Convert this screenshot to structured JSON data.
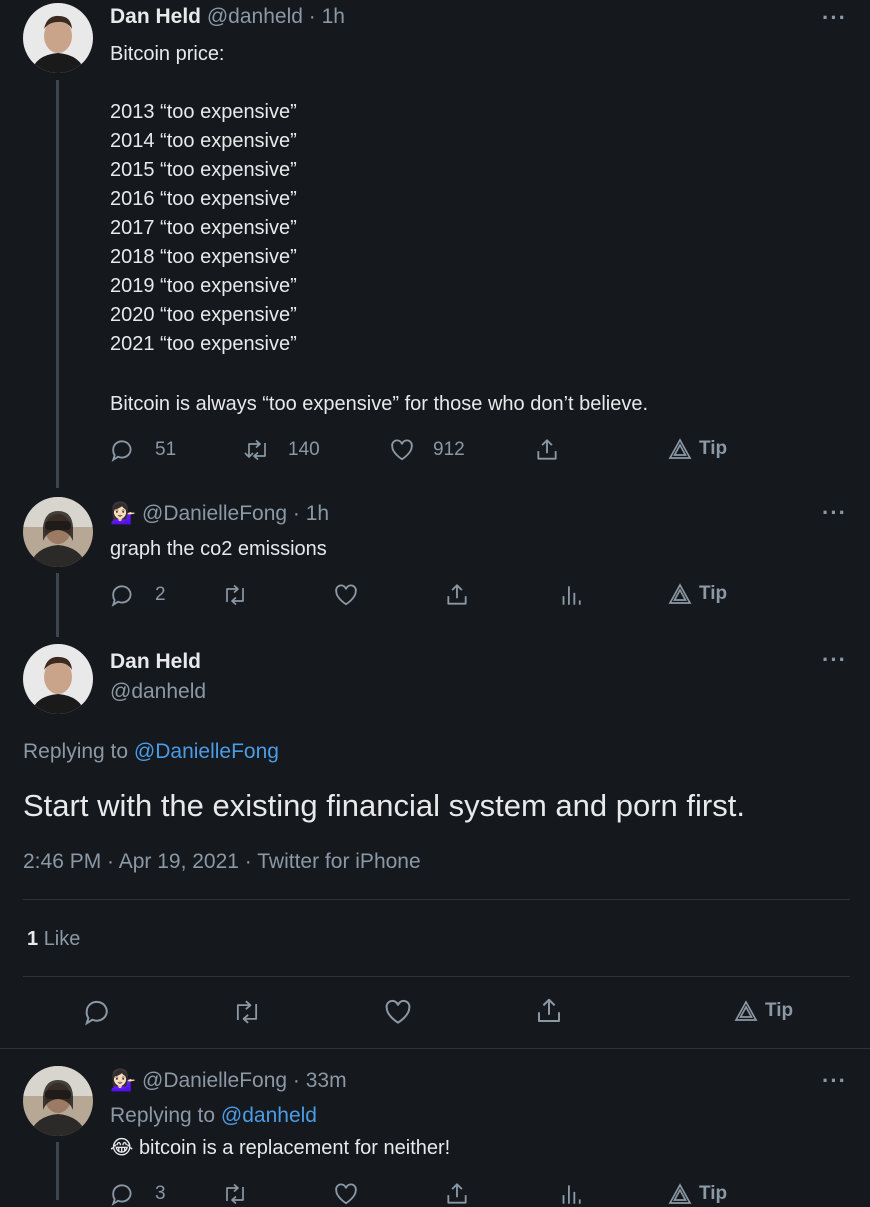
{
  "tweet1": {
    "name": "Dan Held",
    "handle": "@danheld",
    "time": "· 1h",
    "intro": "Bitcoin price:",
    "lines": [
      "2013 “too expensive”",
      "2014 “too expensive”",
      "2015 “too expensive”",
      "2016 “too expensive”",
      "2017 “too expensive”",
      "2018 “too expensive”",
      "2019 “too expensive”",
      "2020 “too expensive”",
      "2021 “too expensive”"
    ],
    "outro": "Bitcoin is always “too expensive” for those who don’t believe.",
    "replies": "51",
    "retweets": "140",
    "likes": "912",
    "tip": "Tip"
  },
  "tweet2": {
    "emoji": "💁🏻‍♀️",
    "handle": "@DanielleFong",
    "time": "· 1h",
    "text": "graph the co2 emissions",
    "replies": "2",
    "tip": "Tip"
  },
  "main": {
    "name": "Dan Held",
    "handle": "@danheld",
    "replying_prefix": "Replying to",
    "replying_to": "@DanielleFong",
    "text": "Start with the existing financial system and porn first.",
    "meta": "2:46 PM · Apr 19, 2021 · Twitter for iPhone",
    "likes_count": "1",
    "likes_label": "Like",
    "tip": "Tip"
  },
  "tweet3": {
    "emoji": "💁🏻‍♀️",
    "handle": "@DanielleFong",
    "time": "· 33m",
    "replying_prefix": "Replying to",
    "replying_to": "@danheld",
    "emoji_text": "😂",
    "text": "bitcoin is a replacement for neither!",
    "replies": "3",
    "tip": "Tip"
  },
  "more_label": "···",
  "colors": {
    "background": "#15181c",
    "text": "#e7e9ea",
    "muted": "#8b98a5",
    "link": "#4b9ce6",
    "thread_line": "#3d4650"
  }
}
